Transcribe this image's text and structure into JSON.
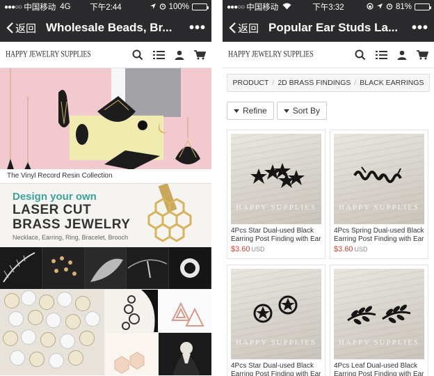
{
  "left": {
    "status": {
      "signal": "●●●○○",
      "carrier": "中国移动",
      "network": "4G",
      "time": "下午2:44",
      "battery_percent": "100%",
      "battery_level": 1.0
    },
    "nav": {
      "back_label": "返回",
      "title": "Wholesale Beads, Br...",
      "more_label": "•••"
    },
    "logo": "HAPPY JEWELRY SUPPLIES",
    "hero_caption": "The Vinyl Record Resin Collection",
    "laser_banner": {
      "line1": "Design your own",
      "line2": "LASER CUT",
      "line3": "BRASS JEWELRY",
      "line4": "Necklace, Earring, Ring, Bracelet, Brooch"
    }
  },
  "right": {
    "status": {
      "signal": "●●●○○",
      "carrier": "中国移动",
      "time": "下午3:32",
      "battery_percent": "81%",
      "battery_level": 0.81
    },
    "nav": {
      "back_label": "返回",
      "title": "Popular Ear Studs La...",
      "more_label": "•••"
    },
    "logo": "HAPPY JEWELRY SUPPLIES",
    "breadcrumb": [
      "PRODUCT",
      "2D BRASS FINDINGS",
      "BLACK EARRINGS"
    ],
    "filters": {
      "refine_label": "Refine",
      "sort_label": "Sort By"
    },
    "products": [
      {
        "title": "4Pcs Star Dual-used Black Earring Post Finding with Ear",
        "price": "$3.60",
        "currency": "USD",
        "watermark": "HAPPY SUPPLIES",
        "motif": "stars"
      },
      {
        "title": "4Pcs Spring Dual-used Black Earring Post Finding with Ear",
        "price": "$3.60",
        "currency": "USD",
        "watermark": "HAPPY SUPPLIES",
        "motif": "spring"
      },
      {
        "title": "4Pcs Star Dual-used Black Earring Post Finding with Ear",
        "price": "",
        "currency": "",
        "watermark": "HAPPY SUPPLIES",
        "motif": "wheel"
      },
      {
        "title": "4Pcs Leaf Dual-used Black Earring Post Finding with Ear",
        "price": "",
        "currency": "",
        "watermark": "HAPPY SUPPLIES",
        "motif": "leaf"
      }
    ]
  },
  "colors": {
    "nav_bg": "#2b2b2d",
    "price": "#d23f2a",
    "laser_accent": "#3aa39b",
    "hero_pink": "#f2c9cf"
  }
}
